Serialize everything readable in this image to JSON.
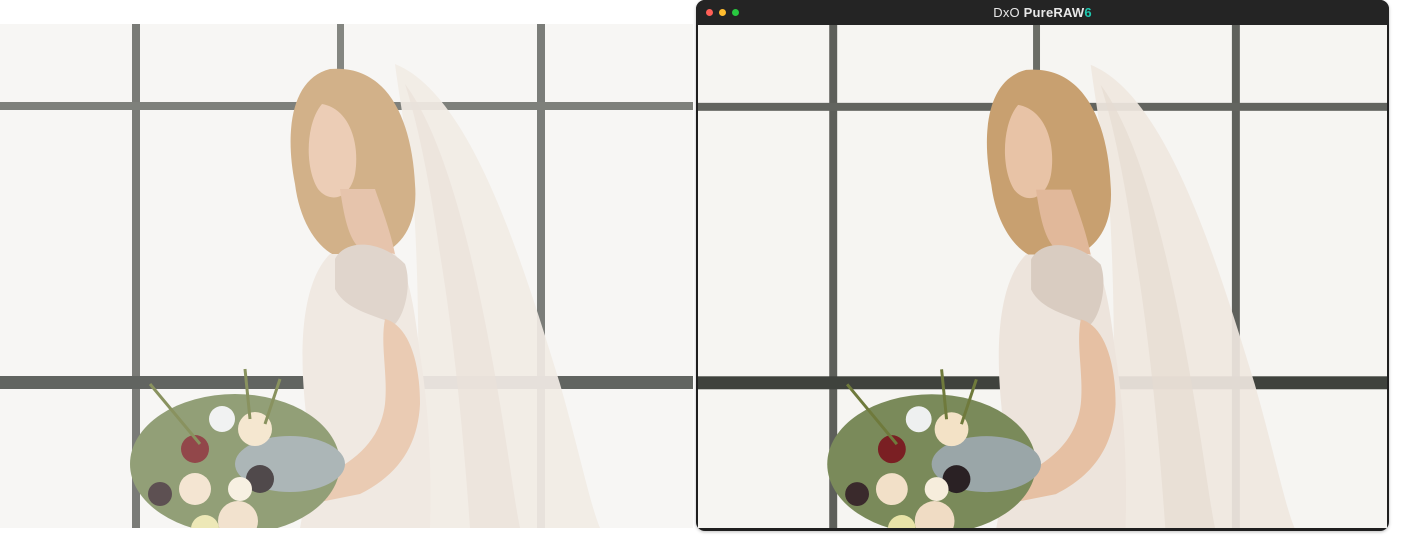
{
  "app": {
    "title_prefix": "DxO",
    "title_name": "PureRAW",
    "title_version": "6",
    "version_color": "#1ec9b0"
  },
  "window_controls": {
    "close_color": "#ff5f57",
    "minimize_color": "#febc2e",
    "zoom_color": "#28c840"
  },
  "images": {
    "before": {
      "subject": "bride-with-veil-and-bouquet",
      "variant": "original-noisy"
    },
    "after": {
      "subject": "bride-with-veil-and-bouquet",
      "variant": "processed-clean"
    }
  }
}
